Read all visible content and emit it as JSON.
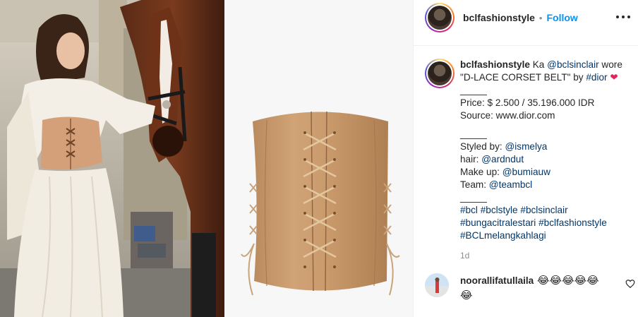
{
  "post": {
    "username": "bclfashionstyle",
    "separator": "•",
    "follow_label": "Follow",
    "more_icon": "more-options-icon"
  },
  "caption": {
    "username": "bclfashionstyle",
    "text_1": " Ka ",
    "mention_1": "@bclsinclair",
    "text_2": " wore",
    "line_2_text": "\"D-LACE CORSET BELT\" by ",
    "hashtag_dior": "#dior",
    "heart_emoji": "❤",
    "sep_1": "_____",
    "price": "Price: $ 2.500 / 35.196.000 IDR",
    "source": "Source: www.dior.com",
    "sep_2": "_____",
    "styled_label": "Styled by: ",
    "styled_mention": "@ismelya",
    "hair_label": "hair: ",
    "hair_mention": "@ardndut",
    "makeup_label": "Make up: ",
    "makeup_mention": "@bumiauw",
    "team_label": "Team: ",
    "team_mention": "@teambcl",
    "sep_3": "_____",
    "hashtags_1": "#bcl #bclstyle #bclsinclair",
    "hashtags_2": "#bungacitralestari #bclfashionstyle",
    "hashtags_3": "#BCLmelangkahlagi",
    "time": "1d"
  },
  "comment": {
    "username": "noorallifatullaila",
    "emoji_line_1": " 😂😂😂😂😂",
    "emoji_line_2": "😂",
    "like_icon": "heart-outline-icon"
  },
  "colors": {
    "link": "#00376b",
    "follow": "#0095f6",
    "muted": "#8e8e8e",
    "corset": "#c79a6a"
  }
}
